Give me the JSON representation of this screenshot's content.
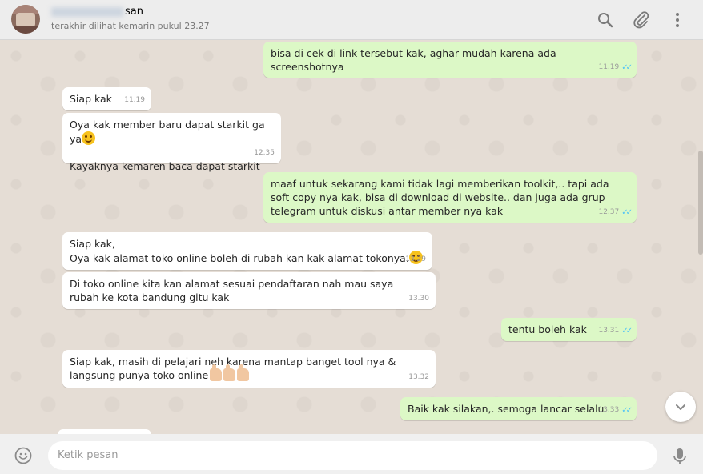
{
  "header": {
    "contact_name_visible": "san",
    "last_seen": "terakhir dilihat kemarin pukul 23.27"
  },
  "icons": {
    "search": "search-icon",
    "attach": "paperclip-icon",
    "menu": "more-vertical-icon",
    "emoji": "smiley-icon",
    "mic": "microphone-icon",
    "scroll_down": "chevron-down-icon"
  },
  "colors": {
    "incoming_bubble": "#ffffff",
    "outgoing_bubble": "#dcf8c6",
    "read_ticks": "#4fc3f7",
    "chat_bg": "#e5ddd5"
  },
  "messages": [
    {
      "dir": "out",
      "text": "bisa di cek di link tersebut kak, aghar mudah karena ada screenshotnya",
      "time": "11.19",
      "read": true
    },
    {
      "dir": "in",
      "text": "Siap kak",
      "time": "11.19"
    },
    {
      "dir": "in",
      "text": "Oya kak member baru dapat starkit ga ya",
      "text2": "Kayaknya kemaren baca dapat starkit",
      "emoji": "smile-emoji",
      "time": "12.35"
    },
    {
      "dir": "out",
      "text": "maaf untuk sekarang kami tidak lagi memberikan toolkit,.. tapi ada soft copy nya kak, bisa di download di website.. dan juga ada grup telegram untuk diskusi antar member nya kak",
      "time": "12.37",
      "read": true
    },
    {
      "dir": "in",
      "text": "Siap kak,",
      "text2": "Oya kak alamat toko online boleh di rubah kan kak alamat tokonya.",
      "emoji": "smile-emoji",
      "time": "13.29"
    },
    {
      "dir": "in",
      "text": "Di toko online kita kan alamat sesuai pendaftaran nah mau saya rubah ke kota bandung gitu kak",
      "time": "13.30"
    },
    {
      "dir": "out",
      "text": "tentu boleh kak",
      "time": "13.31",
      "read": true
    },
    {
      "dir": "in",
      "text": "Siap kak, masih di pelajari neh karena mantap banget tool nya & langsung punya toko online",
      "emoji": "thumbs-up-emoji",
      "time": "13.32"
    },
    {
      "dir": "out",
      "text": "Baik kak silakan,. semoga lancar selalu",
      "time": "13.33",
      "read": true
    }
  ],
  "footer": {
    "placeholder": "Ketik pesan"
  }
}
